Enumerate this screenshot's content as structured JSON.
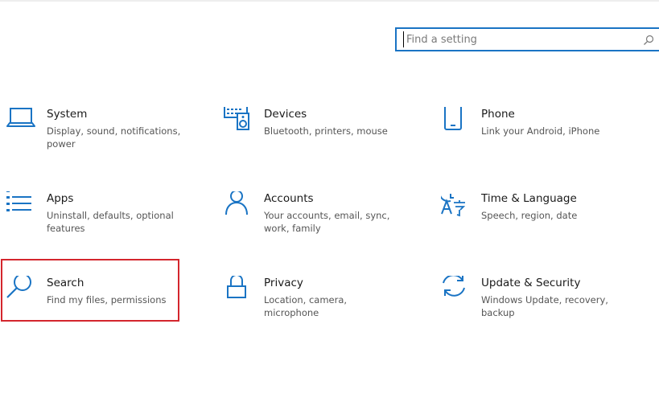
{
  "search": {
    "placeholder": "Find a setting",
    "value": ""
  },
  "tiles": [
    {
      "title": "System",
      "desc": "Display, sound, notifications, power",
      "icon": "laptop-icon"
    },
    {
      "title": "Devices",
      "desc": "Bluetooth, printers, mouse",
      "icon": "keyboard-speaker-icon"
    },
    {
      "title": "Phone",
      "desc": "Link your Android, iPhone",
      "icon": "phone-icon"
    },
    {
      "title": "Apps",
      "desc": "Uninstall, defaults, optional features",
      "icon": "apps-list-icon"
    },
    {
      "title": "Accounts",
      "desc": "Your accounts, email, sync, work, family",
      "icon": "person-icon"
    },
    {
      "title": "Time & Language",
      "desc": "Speech, region, date",
      "icon": "time-language-icon"
    },
    {
      "title": "Search",
      "desc": "Find my files, permissions",
      "icon": "magnifier-icon"
    },
    {
      "title": "Privacy",
      "desc": "Location, camera, microphone",
      "icon": "lock-icon"
    },
    {
      "title": "Update & Security",
      "desc": "Windows Update, recovery, backup",
      "icon": "refresh-icon"
    }
  ],
  "colors": {
    "accent": "#1a74c4",
    "highlight": "#d4262d",
    "title_text": "#1a1a1a",
    "desc_text": "#555555"
  }
}
